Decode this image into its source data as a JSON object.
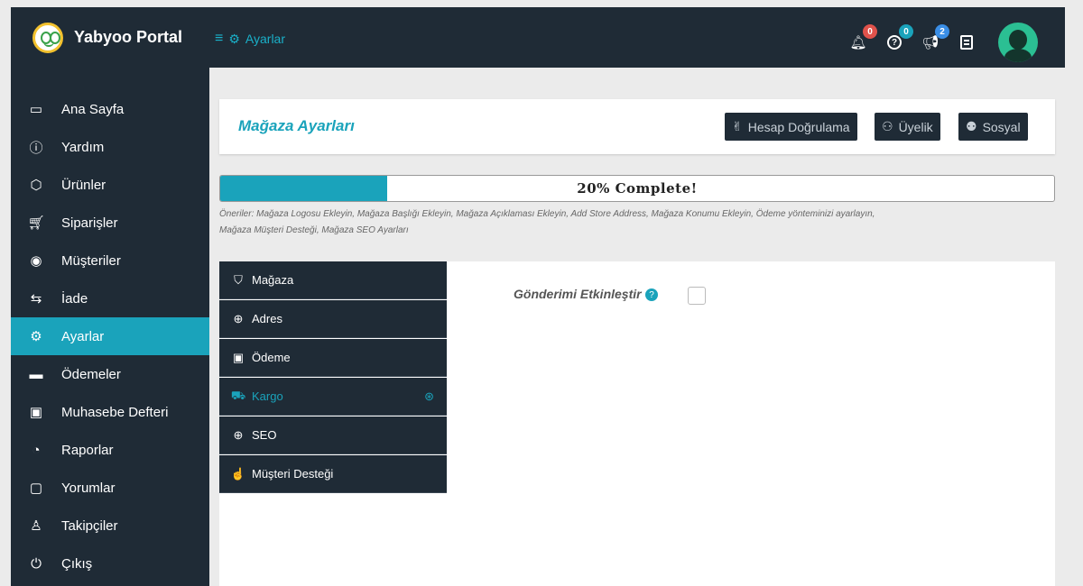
{
  "brand": {
    "name": "Yabyoo Portal"
  },
  "breadcrumb": {
    "menu_icon": "≡",
    "icon": "⚙",
    "label": "Ayarlar"
  },
  "topbar": {
    "notifications": {
      "icon": "🔔",
      "count": "0",
      "color": "#e0524b"
    },
    "help": {
      "icon": "?",
      "count": "0",
      "color": "#1aa3bb"
    },
    "announcements": {
      "icon": "📢",
      "count": "2",
      "color": "#3a8ee6"
    },
    "docs": {
      "icon": "▤"
    }
  },
  "sidebar": {
    "items": [
      {
        "label": "Ana Sayfa",
        "icon": "laptop-icon"
      },
      {
        "label": "Yardım",
        "icon": "help-icon"
      },
      {
        "label": "Ürünler",
        "icon": "box-icon"
      },
      {
        "label": "Siparişler",
        "icon": "cart-icon"
      },
      {
        "label": "Müşteriler",
        "icon": "user-icon"
      },
      {
        "label": "İade",
        "icon": "return-icon"
      },
      {
        "label": "Ayarlar",
        "icon": "gears-icon",
        "active": true
      },
      {
        "label": "Ödemeler",
        "icon": "card-icon"
      },
      {
        "label": "Muhasebe Defteri",
        "icon": "money-icon"
      },
      {
        "label": "Raporlar",
        "icon": "pie-icon"
      },
      {
        "label": "Yorumlar",
        "icon": "comment-icon"
      },
      {
        "label": "Takipçiler",
        "icon": "shirt-icon"
      },
      {
        "label": "Çıkış",
        "icon": "power-icon"
      }
    ]
  },
  "header": {
    "title": "Mağaza Ayarları",
    "buttons": [
      {
        "label": "Hesap Doğrulama",
        "icon": "✌"
      },
      {
        "label": "Üyelik",
        "icon": "👤"
      },
      {
        "label": "Sosyal",
        "icon": "👥"
      }
    ]
  },
  "progress": {
    "percent": 20,
    "label": "20% Complete!",
    "tips": "Öneriler: Mağaza Logosu Ekleyin, Mağaza Başlığı Ekleyin, Mağaza Açıklaması Ekleyin, Add Store Address, Mağaza Konumu Ekleyin, Ödeme yönteminizi ayarlayın, Mağaza Müşteri Desteği, Mağaza SEO Ayarları"
  },
  "tabs": [
    {
      "label": "Mağaza",
      "icon": "🛍"
    },
    {
      "label": "Adres",
      "icon": "🌐"
    },
    {
      "label": "Ödeme",
      "icon": "💵"
    },
    {
      "label": "Kargo",
      "icon": "🚚",
      "active": true,
      "arrow": "➜"
    },
    {
      "label": "SEO",
      "icon": "🌐"
    },
    {
      "label": "Müşteri Desteği",
      "icon": "👍"
    }
  ],
  "shipping": {
    "enable_label": "Gönderimi Etkinleştir",
    "help": "?",
    "enabled": false
  },
  "colors": {
    "accent": "#1aa3bb",
    "dark": "#1f2b36"
  }
}
